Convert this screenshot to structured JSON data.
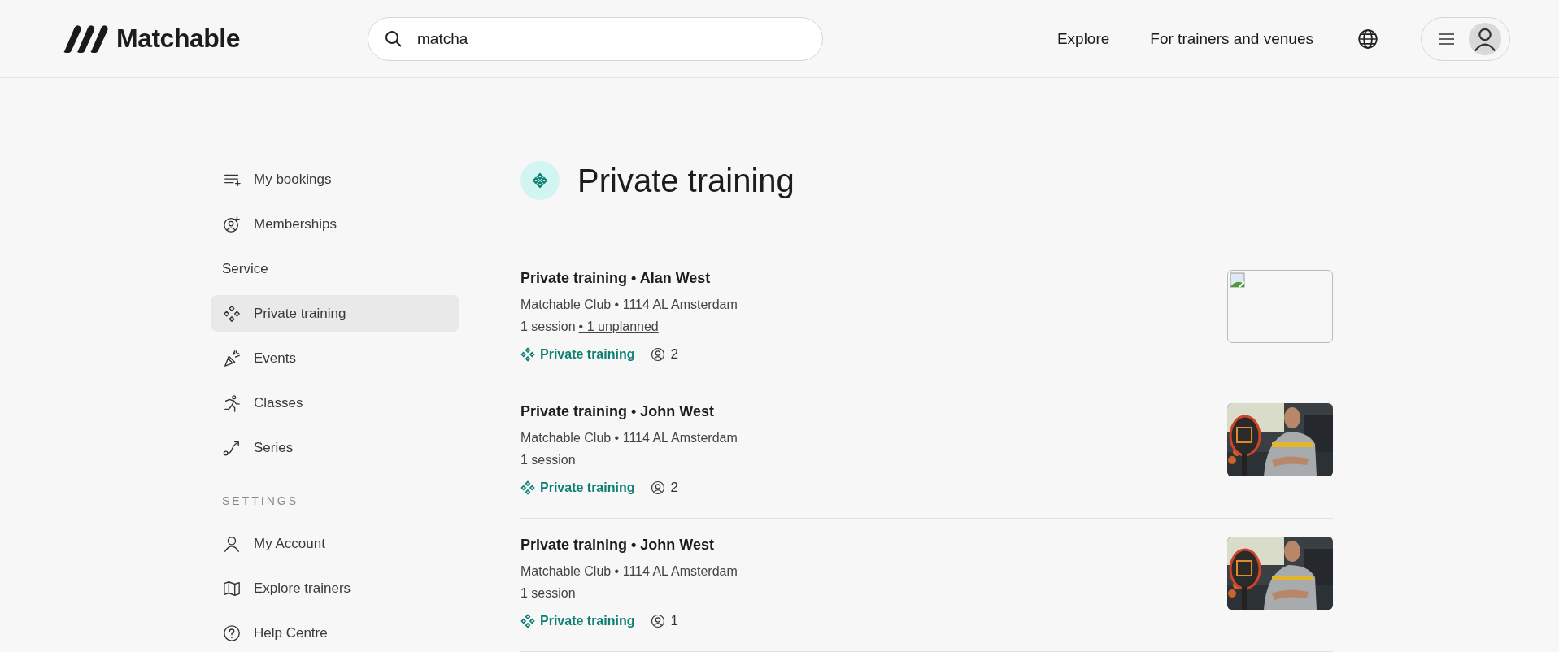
{
  "header": {
    "logo": "Matchable",
    "search": {
      "value": "matcha"
    },
    "nav": [
      "Explore",
      "For trainers and venues"
    ]
  },
  "sidebar": {
    "items": [
      {
        "kind": "link",
        "label": "My bookings",
        "selected": false
      },
      {
        "kind": "link",
        "label": "Memberships",
        "selected": false
      },
      {
        "kind": "group",
        "label": "Service"
      },
      {
        "kind": "link",
        "label": "Private training",
        "selected": true
      },
      {
        "kind": "link",
        "label": "Events",
        "selected": false
      },
      {
        "kind": "link",
        "label": "Classes",
        "selected": false
      },
      {
        "kind": "link",
        "label": "Series",
        "selected": false
      },
      {
        "kind": "section",
        "label": "SETTINGS"
      },
      {
        "kind": "link",
        "label": "My Account",
        "selected": false
      },
      {
        "kind": "link",
        "label": "Explore trainers",
        "selected": false
      },
      {
        "kind": "link",
        "label": "Help Centre",
        "selected": false
      }
    ]
  },
  "page": {
    "title": "Private training"
  },
  "bookings": [
    {
      "title": "Private training • Alan West",
      "location": "Matchable Club • 1114 AL Amsterdam",
      "sessions": "1 session",
      "unplanned": "• 1 unplanned",
      "tag": "Private training",
      "participants": "2",
      "image": {
        "kind": "broken"
      }
    },
    {
      "title": "Private training • John West",
      "location": "Matchable Club • 1114 AL Amsterdam",
      "sessions": "1 session",
      "tag": "Private training",
      "participants": "2"
    },
    {
      "title": "Private training • John West",
      "location": "Matchable Club • 1114 AL Amsterdam",
      "sessions": "1 session",
      "tag": "Private training",
      "participants": "1"
    }
  ]
}
